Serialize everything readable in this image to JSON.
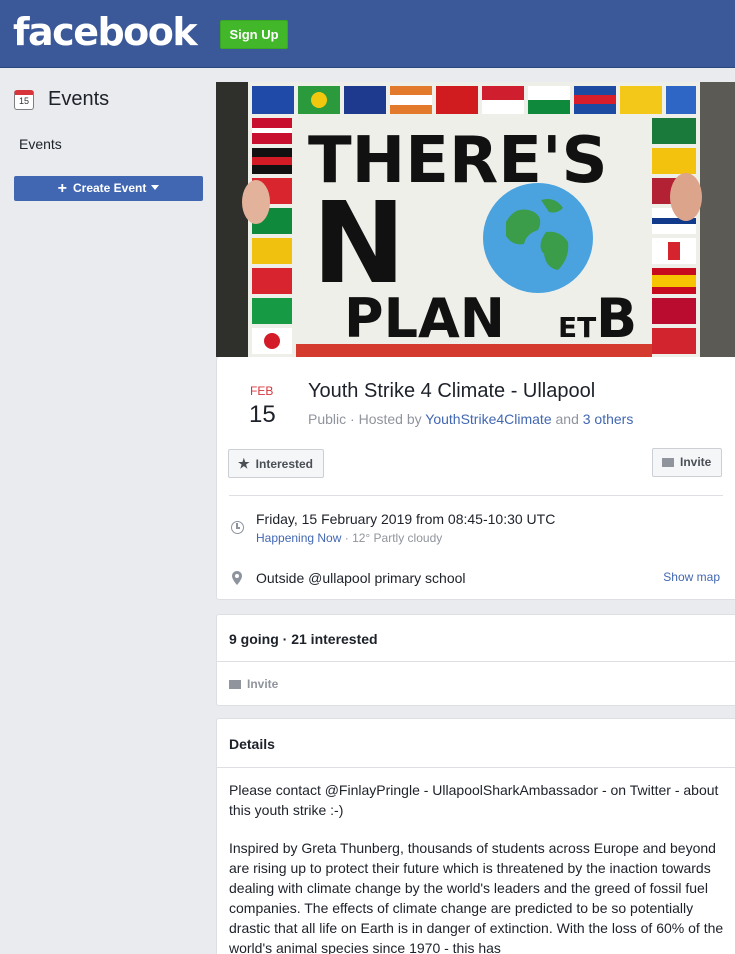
{
  "header": {
    "logo": "facebook",
    "signup_label": "Sign Up"
  },
  "sidebar": {
    "title": "Events",
    "calendar_icon_day": "15",
    "link": "Events",
    "create_event_label": "Create Event"
  },
  "cover": {
    "sign_line1": "THERE'S",
    "sign_line2": "N",
    "sign_line3": "PLAN",
    "sign_et": "ET",
    "sign_b": "B"
  },
  "event": {
    "month": "FEB",
    "day": "15",
    "title": "Youth Strike 4 Climate - Ullapool",
    "privacy": "Public",
    "hosted_by_prefix": "Hosted by",
    "host": "YouthStrike4Climate",
    "and": "and",
    "others": "3 others",
    "interested_label": "Interested",
    "invite_label": "Invite",
    "datetime": "Friday, 15 February 2019 from 08:45-10:30 UTC",
    "happening": "Happening Now",
    "weather": "12° Partly cloudy",
    "location": "Outside @ullapool primary school",
    "show_map": "Show map"
  },
  "attendance": {
    "summary": "9 going · 21 interested",
    "invite_label": "Invite"
  },
  "details": {
    "heading": "Details",
    "para1": "Please contact  @FinlayPringle - UllapoolSharkAmbassador  - on Twitter - about this youth strike :-)",
    "para2": "Inspired by Greta Thunberg, thousands of students across Europe and beyond are rising up to protect their future which is threatened by the inaction towards dealing with climate change by the world's leaders and the greed of fossil fuel companies. The effects of climate change are predicted to be so potentially drastic that all life on Earth is in danger of extinction. With the loss of 60% of the world's animal species since 1970 - this has"
  },
  "colors": {
    "fb_blue": "#3b5998",
    "signup_green": "#42b72a",
    "link_blue": "#4267b2",
    "date_red": "#d8343c"
  }
}
